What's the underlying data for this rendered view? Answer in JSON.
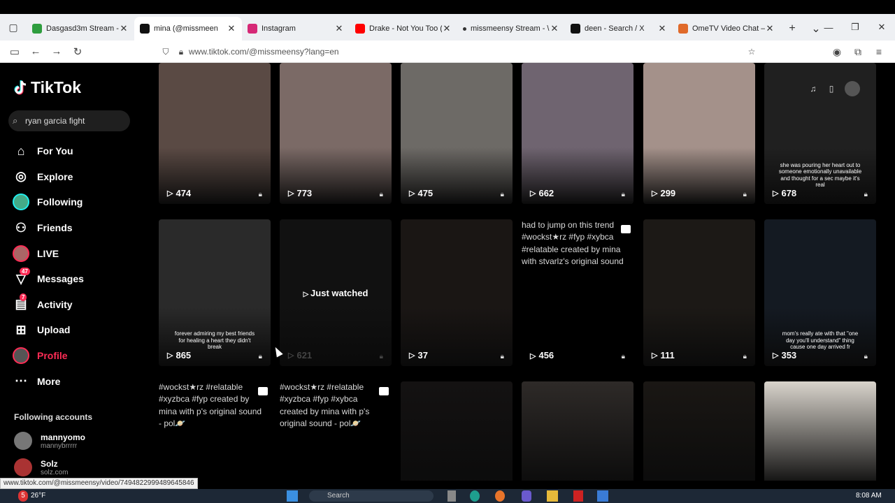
{
  "browser": {
    "tabs": [
      {
        "title": "Dasgasd3m Stream - \\",
        "color": "#2e9d3e",
        "active": false
      },
      {
        "title": "mina (@missmeen",
        "color": "#111111",
        "active": true
      },
      {
        "title": "Instagram",
        "color": "#d62976",
        "active": false
      },
      {
        "title": "Drake - Not You Too (\\",
        "color": "#ff0000",
        "active": false
      },
      {
        "title": "missmeensy Stream - \\",
        "color": "#ffffff",
        "active": false
      },
      {
        "title": "deen - Search / X",
        "color": "#111111",
        "active": false
      },
      {
        "title": "OmeTV Video Chat —",
        "color": "#e06a2a",
        "active": false
      }
    ],
    "url": "www.tiktok.com/@missmeensy?lang=en",
    "status_url": "www.tiktok.com/@missmeensy/video/7494822999489645846"
  },
  "tiktok": {
    "logo": "TikTok",
    "search_value": "ryan garcia fight",
    "nav": [
      {
        "label": "For You",
        "icon": "home-icon"
      },
      {
        "label": "Explore",
        "icon": "compass-icon"
      },
      {
        "label": "Following",
        "icon": "following-avatar-icon"
      },
      {
        "label": "Friends",
        "icon": "friends-icon"
      },
      {
        "label": "LIVE",
        "icon": "live-avatar-icon"
      },
      {
        "label": "Messages",
        "icon": "messages-icon",
        "badge": "47"
      },
      {
        "label": "Activity",
        "icon": "activity-icon",
        "badge": "7"
      },
      {
        "label": "Upload",
        "icon": "upload-icon"
      },
      {
        "label": "Profile",
        "icon": "profile-avatar-icon",
        "active": true
      },
      {
        "label": "More",
        "icon": "more-icon"
      }
    ],
    "following_header": "Following accounts",
    "accounts": [
      {
        "name": "mannyomo",
        "handle": "mannybrrrrr"
      },
      {
        "name": "Solz",
        "handle": "solz.com"
      }
    ],
    "row1": [
      {
        "views": "474",
        "color": "#5a4a44"
      },
      {
        "views": "773",
        "color": "#7b6a66"
      },
      {
        "views": "475",
        "color": "#6d6a66"
      },
      {
        "views": "662",
        "color": "#6f6470"
      },
      {
        "views": "299",
        "color": "#a4918a"
      },
      {
        "views": "678",
        "color": "#202020",
        "overlay": "she was pouring her heart out to someone emotionally unavailable and thought for a sec maybe it's real"
      }
    ],
    "row2": [
      {
        "views": "865",
        "color": "#2a2a2a",
        "overlay": "forever admiring my best friends for healing a heart they didn't break"
      },
      {
        "views": "621",
        "color": "#111111",
        "just_watched": "Just watched"
      },
      {
        "views": "37",
        "color": "#1a1614"
      },
      {
        "views": "456",
        "caption": "had to jump on this trend #wockst★rz #fyp #xybca #relatable created by mina with stvarlz's original sound"
      },
      {
        "views": "111",
        "color": "#1c1916"
      },
      {
        "views": "353",
        "color": "#141a22",
        "overlay": "mom's really ate with that \"one day you'll understand\" thing cause one day arrived fr"
      }
    ],
    "row3_captions": [
      "#wockst★rz #relatable #xyzbca #fyp created by mina with p's original sound - pol🪐",
      "#wockst★rz #relatable #xyzbca #fyp #xybca created by mina with p's original sound - pol🪐"
    ],
    "row3_colors": [
      "#141212",
      "#2e2a28",
      "#1a1714",
      "#d9d4cc"
    ]
  },
  "taskbar": {
    "weather": "26°F",
    "weather_badge": "5",
    "search": "Search",
    "time": "8:08 AM"
  }
}
